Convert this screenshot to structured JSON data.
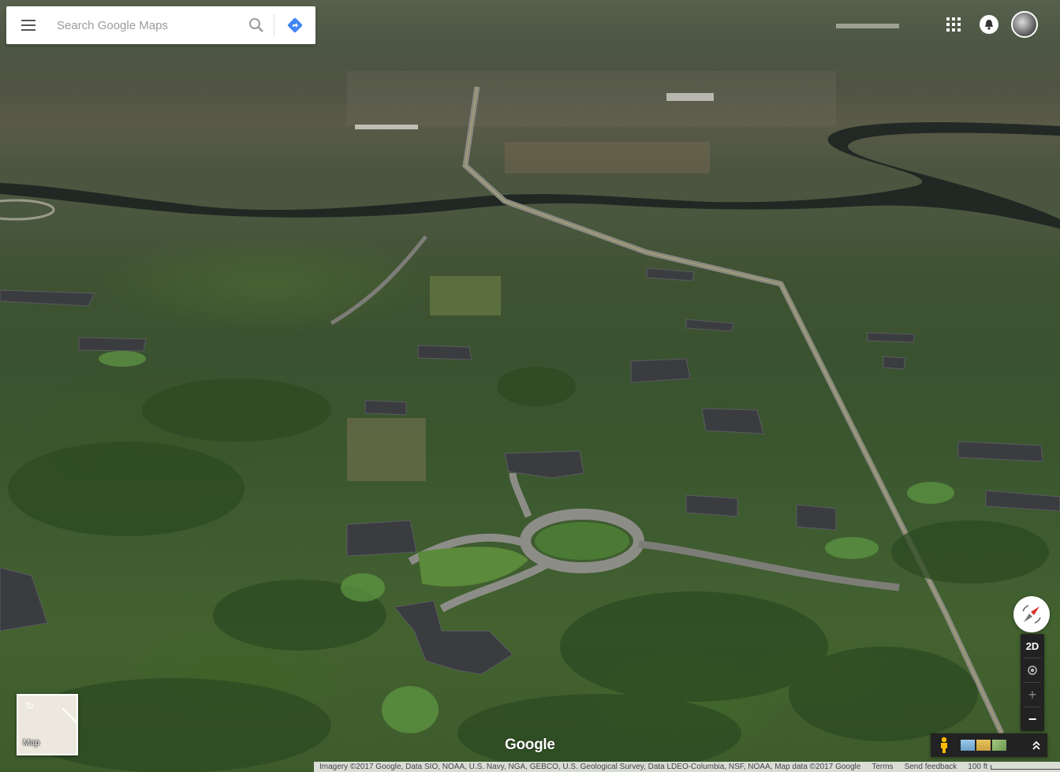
{
  "search": {
    "placeholder": "Search Google Maps"
  },
  "icons": {
    "menu": "hamburger-menu-icon",
    "search": "search-icon",
    "directions": "directions-icon",
    "apps": "apps-grid-icon",
    "notifications": "notifications-icon",
    "account": "avatar",
    "compass": "compass-icon",
    "pegman": "pegman-icon",
    "expand": "chevron-up-icon"
  },
  "view_controls": {
    "mode_label": "2D",
    "zoom_in": "+",
    "zoom_out": "−"
  },
  "minimap": {
    "label": "Map"
  },
  "logo": {
    "text": "Google"
  },
  "footer": {
    "attribution": "Imagery ©2017 Google, Data SIO, NOAA, U.S. Navy, NGA, GEBCO, U.S. Geological Survey, Data LDEO-Columbia, NSF, NOAA, Map data ©2017 Google",
    "terms": "Terms",
    "feedback": "Send feedback",
    "scale": "100 ft"
  },
  "colors": {
    "directions_blue": "#4285f4",
    "compass_red": "#d93025",
    "control_dark": "#222222"
  }
}
